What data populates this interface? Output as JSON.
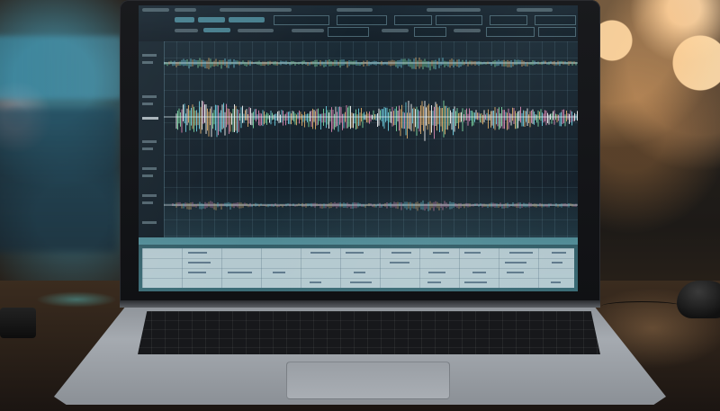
{
  "scene": {
    "subject": "laptop-with-audio-waveform-display",
    "background": "blurred-bokeh-room",
    "screen_content": "audio-editor-waveform"
  },
  "icons": [
    "waveform-icon"
  ],
  "colors": {
    "waveform_main": "#6fd3e6",
    "waveform_warm": "#e5b36c",
    "waveform_green": "#7fe0a6",
    "waveform_pink": "#e38bb8",
    "screen_bg": "#17242e",
    "bokeh_warm": "#ffd6a0",
    "bokeh_cool": "#50b4d2",
    "desk": "#3b2c1f"
  }
}
